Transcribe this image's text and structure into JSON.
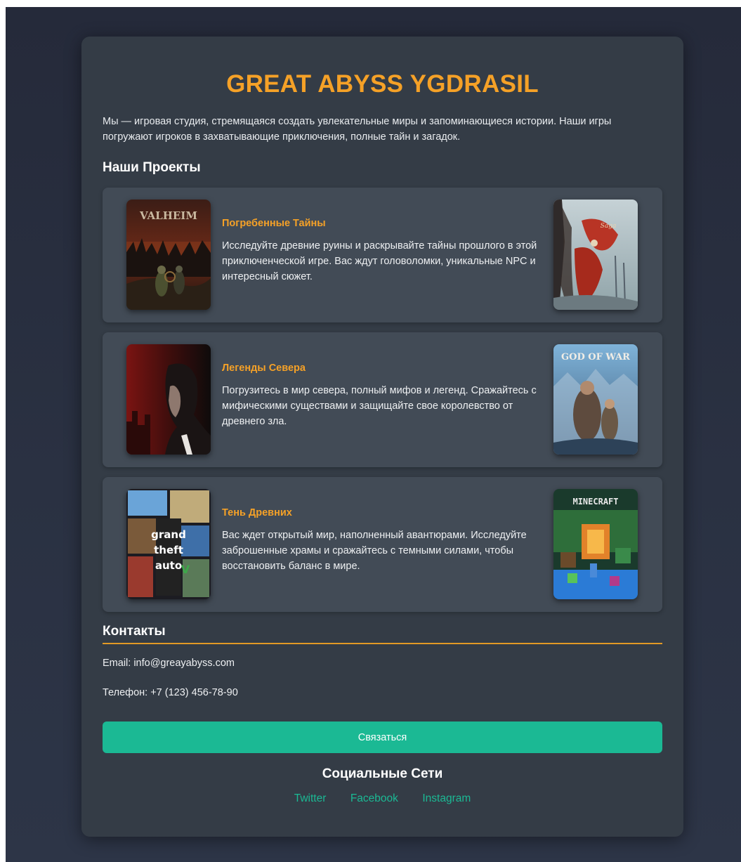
{
  "header": {
    "title": "GREAT ABYSS YGDRASIL",
    "intro": "Мы — игровая студия, стремящаяся создать увлекательные миры и запоминающиеся истории. Наши игры погружают игроков в захватывающие приключения, полные тайн и загадок."
  },
  "projects_section": {
    "title": "Наши Проекты",
    "items": [
      {
        "title": "Погребенные Тайны",
        "description": "Исследуйте древние руины и раскрывайте тайны прошлого в этой приключенческой игре. Вас ждут головоломки, уникальные NPC и интересный сюжет.",
        "left_cover_text": "VALHEIM",
        "right_cover_text": ""
      },
      {
        "title": "Легенды Севера",
        "description": "Погрузитесь в мир севера, полный мифов и легенд. Сражайтесь с мифическими существами и защищайте свое королевство от древнего зла.",
        "left_cover_text": "",
        "right_cover_text": "GOD OF WAR"
      },
      {
        "title": "Тень Древних",
        "description": "Вас ждет открытый мир, наполненный авантюрами. Исследуйте заброшенные храмы и сражайтесь с темными силами, чтобы восстановить баланс в мире.",
        "left_cover_text": "Grand Theft Auto V",
        "right_cover_text": "MINECRAFT"
      }
    ]
  },
  "contacts": {
    "title": "Контакты",
    "email": "Email: info@greayabyss.com",
    "phone": "Телефон: +7 (123) 456-78-90",
    "button_label": "Связаться"
  },
  "social": {
    "title": "Социальные Сети",
    "links": [
      "Twitter",
      "Facebook",
      "Instagram"
    ]
  },
  "colors": {
    "accent": "#f5a127",
    "button": "#1bb994",
    "card": "#343c46",
    "project_card": "#424b56"
  }
}
